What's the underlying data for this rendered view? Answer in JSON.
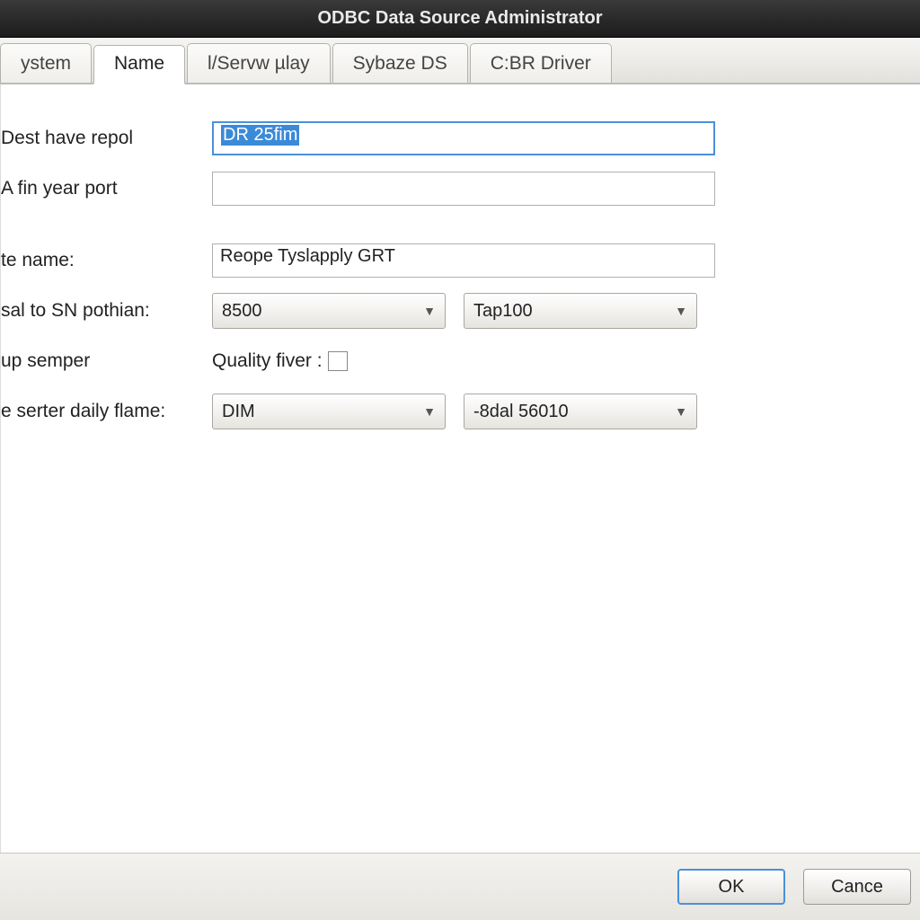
{
  "window": {
    "title": "ODBC Data Source Administrator"
  },
  "tabs": [
    {
      "label": "ystem"
    },
    {
      "label": "Name"
    },
    {
      "label": "l/Servw µlay"
    },
    {
      "label": "Sybaze DS"
    },
    {
      "label": "C:BR Driver"
    }
  ],
  "form": {
    "dest_label": "Dest have repol",
    "dest_value": "DR 25fim",
    "fin_label": "A fin year port",
    "fin_value": "",
    "tename_label": "te name:",
    "tename_value": "Reope Tyslapply GRT",
    "sn_label": "sal to SN pothian:",
    "sn_value1": "8500",
    "sn_value2": "Tap100",
    "semper_label": "up semper",
    "quality_label": "Quality fiver :",
    "flame_label": "e serter daily flame:",
    "flame_value1": "DIM",
    "flame_value2": "-8dal 56010"
  },
  "buttons": {
    "ok": "OK",
    "cancel": "Cance"
  }
}
